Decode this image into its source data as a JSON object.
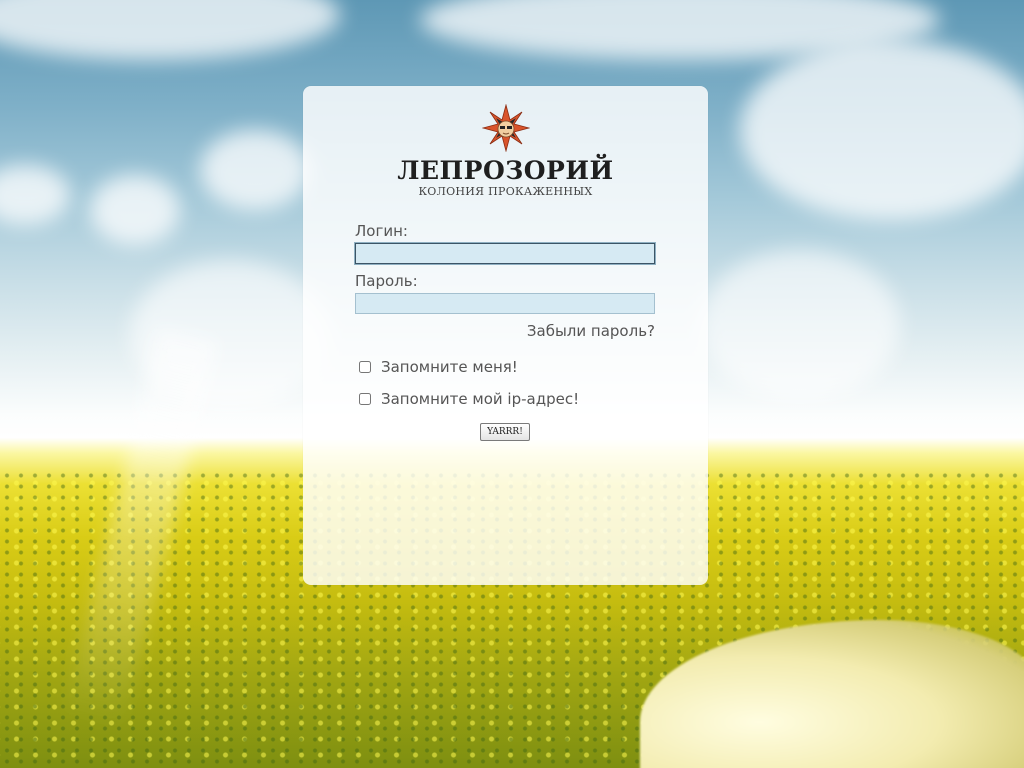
{
  "brand": {
    "logo_icon": "leper-star-logo",
    "title": "ЛЕПРОЗОРИЙ",
    "subtitle": "КОЛОНИЯ ПРОКАЖЕННЫХ"
  },
  "login_form": {
    "login_label": "Логин:",
    "login_value": "",
    "password_label": "Пароль:",
    "password_value": "",
    "forgot_link": "Забыли пароль?",
    "remember_me": "Запомните меня!",
    "remember_me_checked": false,
    "remember_ip": "Запомните мой ip-адрес!",
    "remember_ip_checked": false,
    "submit_label": "YARRR!"
  },
  "colors": {
    "panel_bg": "#ffffff",
    "input_bg": "#d6eaf3",
    "text": "#555555",
    "logo_star": "#d9542b"
  }
}
